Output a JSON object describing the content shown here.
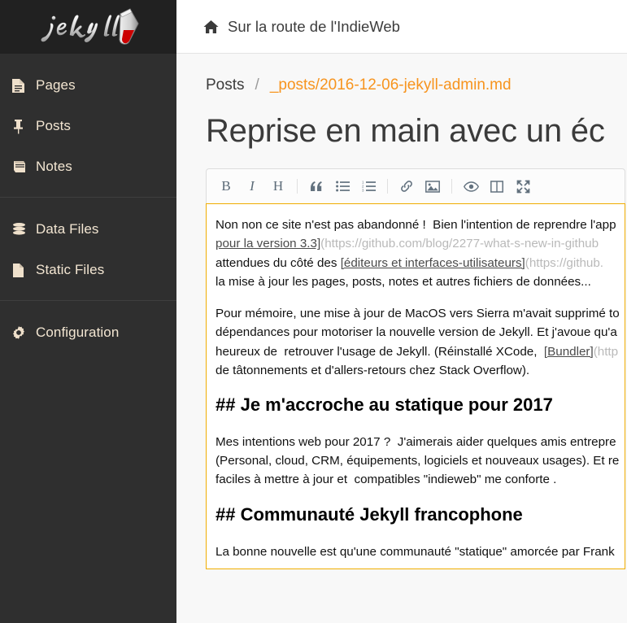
{
  "sidebar": {
    "brand": {
      "logo_text": "jekyll",
      "icon": "test-tube-icon"
    },
    "groups": [
      {
        "items": [
          {
            "label": "Pages",
            "icon": "file-lines-icon"
          },
          {
            "label": "Posts",
            "icon": "thumbtack-icon"
          },
          {
            "label": "Notes",
            "icon": "book-icon"
          }
        ]
      },
      {
        "items": [
          {
            "label": "Data Files",
            "icon": "database-icon"
          },
          {
            "label": "Static Files",
            "icon": "file-icon"
          }
        ]
      },
      {
        "items": [
          {
            "label": "Configuration",
            "icon": "gear-icon"
          }
        ]
      }
    ]
  },
  "topbar": {
    "home_icon": "home-icon",
    "site_title": "Sur la route de l'IndieWeb"
  },
  "breadcrumb": {
    "root": "Posts",
    "separator": "/",
    "file": "_posts/2016-12-06-jekyll-admin.md"
  },
  "document": {
    "title": "Reprise en main avec un éc"
  },
  "toolbar": {
    "buttons": [
      {
        "name": "bold-button",
        "glyph": "B",
        "title": "Bold"
      },
      {
        "name": "italic-button",
        "glyph": "I",
        "title": "Italic"
      },
      {
        "name": "heading-button",
        "glyph": "H",
        "title": "Heading"
      },
      {
        "name": "quote-button",
        "glyph": "quote-icon",
        "title": "Quote"
      },
      {
        "name": "unordered-list-button",
        "glyph": "list-ul-icon",
        "title": "Generic List"
      },
      {
        "name": "ordered-list-button",
        "glyph": "list-ol-icon",
        "title": "Numbered List"
      },
      {
        "name": "link-button",
        "glyph": "link-icon",
        "title": "Create Link"
      },
      {
        "name": "image-button",
        "glyph": "image-icon",
        "title": "Insert Image"
      },
      {
        "name": "preview-button",
        "glyph": "eye-icon",
        "title": "Toggle Preview"
      },
      {
        "name": "side-by-side-button",
        "glyph": "columns-icon",
        "title": "Toggle Side by Side"
      },
      {
        "name": "fullscreen-button",
        "glyph": "arrows-alt-icon",
        "title": "Toggle Fullscreen"
      }
    ]
  },
  "editor": {
    "blocks": [
      {
        "type": "paragraph",
        "lines": [
          [
            {
              "t": "Non non ce site n'est pas abandonné !  Bien l'intention de reprendre l'app",
              "s": "plain"
            }
          ],
          [
            {
              "t": "pour la version 3.3]",
              "s": "link"
            },
            {
              "t": "(https://github.com/blog/2277-what-s-new-in-github",
              "s": "url"
            }
          ],
          [
            {
              "t": "attendues du côté des ",
              "s": "plain"
            },
            {
              "t": "[éditeurs et interfaces-utilisateurs]",
              "s": "link"
            },
            {
              "t": "(https://github.",
              "s": "url"
            }
          ],
          [
            {
              "t": "la mise à jour les pages, posts, notes et autres fichiers de données...",
              "s": "plain"
            }
          ]
        ]
      },
      {
        "type": "paragraph",
        "lines": [
          [
            {
              "t": "Pour mémoire, une mise à jour de MacOS vers Sierra m'avait supprimé to",
              "s": "plain"
            }
          ],
          [
            {
              "t": "dépendances pour motoriser la nouvelle version de Jekyll. Et j'avoue qu'a",
              "s": "plain"
            }
          ],
          [
            {
              "t": "heureux de  retrouver l'usage de Jekyll. (Réinstallé XCode,  ",
              "s": "plain"
            },
            {
              "t": "[Bundler]",
              "s": "link"
            },
            {
              "t": "(http",
              "s": "url"
            }
          ],
          [
            {
              "t": "de tâtonnements et d'allers-retours chez Stack Overflow).",
              "s": "plain"
            }
          ]
        ]
      },
      {
        "type": "heading",
        "text": "## Je m'accroche au statique pour 2017"
      },
      {
        "type": "paragraph",
        "lines": [
          [
            {
              "t": "Mes intentions web pour 2017 ?  J'aimerais aider quelques amis entrepre",
              "s": "plain"
            }
          ],
          [
            {
              "t": "(Personal, cloud, CRM, équipements, logiciels et nouveaux usages). Et re",
              "s": "plain"
            }
          ],
          [
            {
              "t": "faciles à mettre à jour et  compatibles \"indieweb\" me conforte .",
              "s": "plain"
            }
          ]
        ]
      },
      {
        "type": "heading",
        "text": "## Communauté Jekyll francophone"
      },
      {
        "type": "paragraph",
        "lines": [
          [
            {
              "t": "La bonne nouvelle est qu'une communauté \"statique\" amorcée par Frank",
              "s": "plain"
            }
          ]
        ]
      }
    ]
  },
  "colors": {
    "sidebar_bg": "#2f2f2f",
    "sidebar_brand_bg": "#212121",
    "sidebar_text": "#f3e6d2",
    "accent_orange": "#f7941e",
    "editor_border": "#f0ad00",
    "page_bg": "#f8f8f8"
  }
}
